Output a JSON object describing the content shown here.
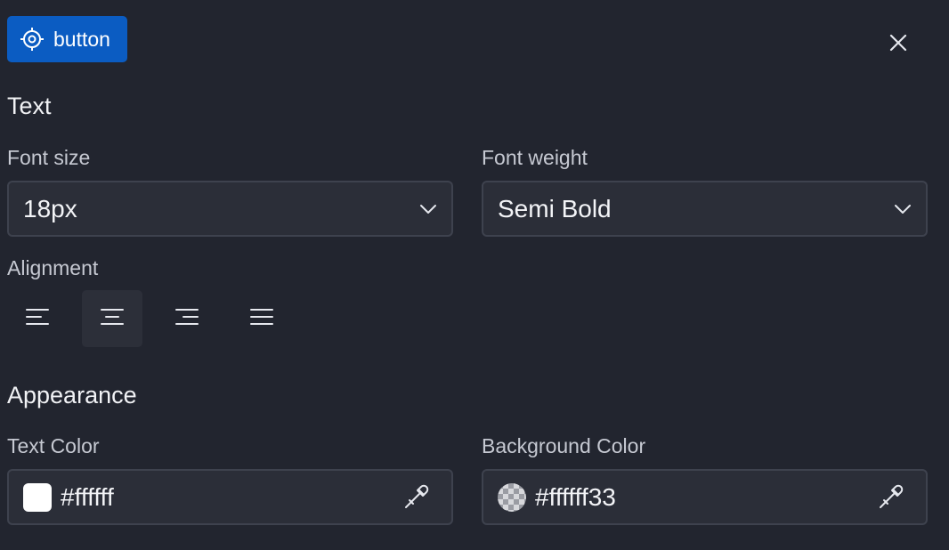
{
  "header": {
    "element_tag": "button",
    "tag_icon": "target-icon",
    "close_icon": "close-icon"
  },
  "text_section": {
    "title": "Text",
    "font_size": {
      "label": "Font size",
      "value": "18px"
    },
    "font_weight": {
      "label": "Font weight",
      "value": "Semi Bold"
    },
    "alignment": {
      "label": "Alignment",
      "options": [
        {
          "name": "align-left-icon",
          "active": false
        },
        {
          "name": "align-center-icon",
          "active": true
        },
        {
          "name": "align-right-icon",
          "active": false
        },
        {
          "name": "align-justify-icon",
          "active": false
        }
      ]
    }
  },
  "appearance_section": {
    "title": "Appearance",
    "text_color": {
      "label": "Text Color",
      "value": "#ffffff"
    },
    "background_color": {
      "label": "Background Color",
      "value": "#ffffff33"
    }
  },
  "colors": {
    "background": "#22252f",
    "accent": "#0b5cc2",
    "input_bg": "#2b2e38",
    "input_border": "#3e424e"
  }
}
